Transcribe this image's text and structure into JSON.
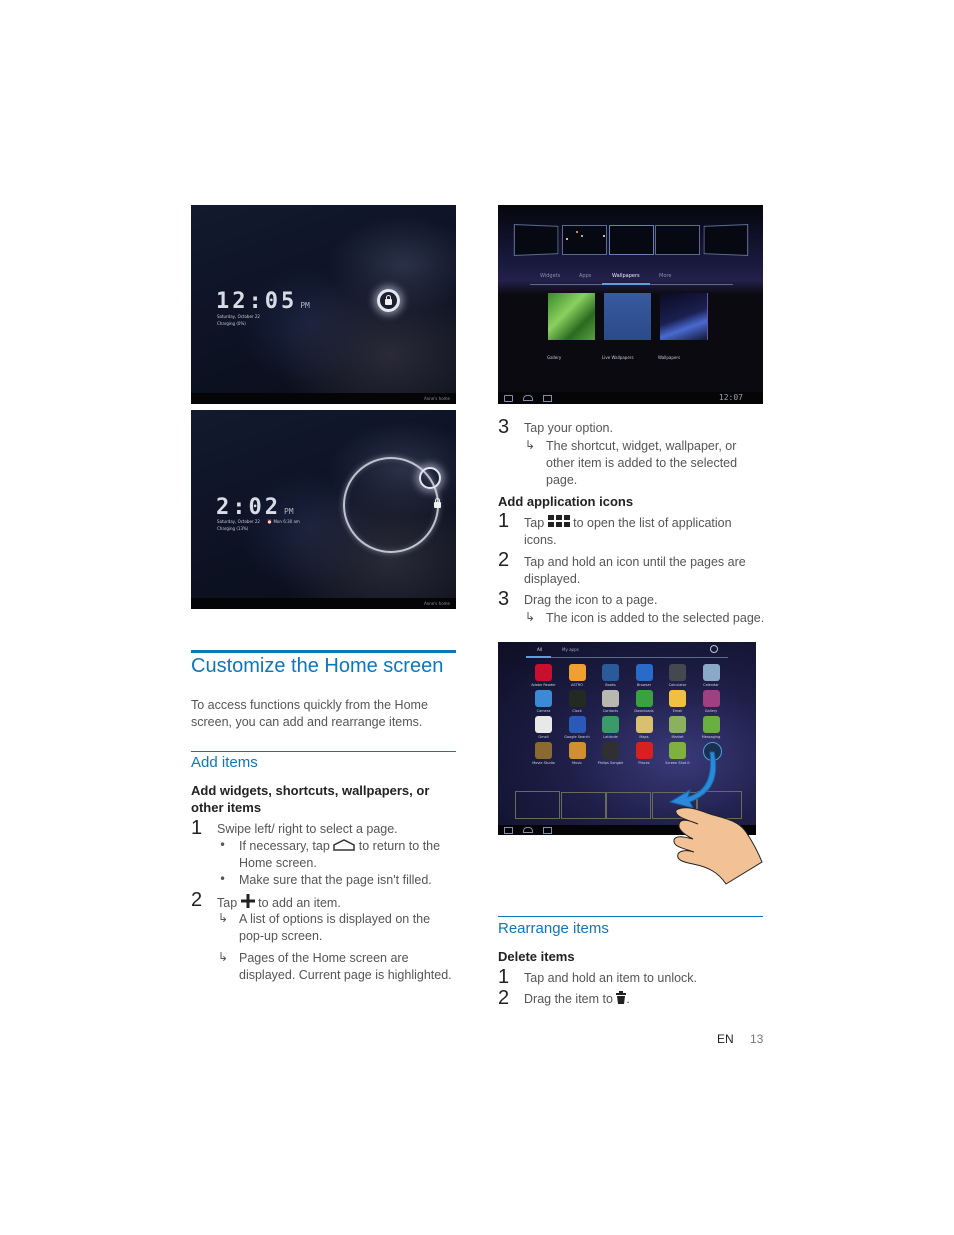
{
  "screenshots": {
    "lock1": {
      "time": "12:05",
      "ampm": "PM",
      "date": "Saturday, October 22",
      "charging": "Charging (0%)",
      "status": "Anne's home"
    },
    "lock2": {
      "time": "2:02",
      "ampm": "PM",
      "date": "Saturday, October 22",
      "alarm": "Mon 6:30 am",
      "charging": "Charging (13%)",
      "status": "Anne's home"
    },
    "wallpaper_picker": {
      "tabs": [
        "Widgets",
        "Apps",
        "Wallpapers",
        "More"
      ],
      "active_tab": "Wallpapers",
      "options": [
        "Gallery",
        "Live Wallpapers",
        "Wallpapers"
      ],
      "clock": "12:07"
    },
    "app_drawer": {
      "tabs": [
        "All",
        "My apps"
      ],
      "active_tab": "All",
      "apps": [
        {
          "label": "Adobe Reader",
          "color": "#c8102e"
        },
        {
          "label": "ASTRO",
          "color": "#f0a030"
        },
        {
          "label": "Books",
          "color": "#2a5a9a"
        },
        {
          "label": "Browser",
          "color": "#2a6ac8"
        },
        {
          "label": "Calculator",
          "color": "#444850"
        },
        {
          "label": "Calendar",
          "color": "#8aa8c8"
        },
        {
          "label": "Camera",
          "color": "#3a8ad8"
        },
        {
          "label": "Clock",
          "color": "#222a22"
        },
        {
          "label": "Contacts",
          "color": "#b8b8b0"
        },
        {
          "label": "Downloads",
          "color": "#3aa040"
        },
        {
          "label": "Email",
          "color": "#f0c040"
        },
        {
          "label": "Gallery",
          "color": "#a04080"
        },
        {
          "label": "Gmail",
          "color": "#e8e8e8"
        },
        {
          "label": "Google Search",
          "color": "#2a5ab8"
        },
        {
          "label": "Latitude",
          "color": "#3a9a6a"
        },
        {
          "label": "Maps",
          "color": "#d8c070"
        },
        {
          "label": "Market",
          "color": "#8ab060"
        },
        {
          "label": "Messaging",
          "color": "#6ab040"
        },
        {
          "label": "Movie Studio",
          "color": "#8a6a30"
        },
        {
          "label": "Music",
          "color": "#d09030"
        },
        {
          "label": "Philips Songbir",
          "color": "#303030"
        },
        {
          "label": "Places",
          "color": "#d82020"
        },
        {
          "label": "Screen Shot it",
          "color": "#80b040"
        },
        {
          "label": "",
          "color": "#1a3050"
        }
      ]
    }
  },
  "left_column": {
    "section_title": "Customize the Home screen",
    "intro": "To access functions quickly from the Home screen, you can add and rearrange items.",
    "subsection_title": "Add items",
    "subheading": "Add widgets, shortcuts, wallpapers, or other items",
    "steps": [
      {
        "num": "1",
        "text": "Swipe left/ right to select a page.",
        "bullets": [
          {
            "before": "If necessary, tap",
            "icon": "home-icon",
            "after": "to return to the Home screen."
          },
          {
            "text": "Make sure that the page isn't filled."
          }
        ]
      },
      {
        "num": "2",
        "before": "Tap",
        "icon": "plus-icon",
        "after": "to add an item.",
        "results": [
          "A list of options is displayed on the pop-up screen.",
          "Pages of the Home screen are displayed. Current page is highlighted."
        ]
      }
    ]
  },
  "right_column": {
    "step3": {
      "num": "3",
      "text": "Tap your option.",
      "result": "The shortcut, widget, wallpaper, or other item is added to the selected page."
    },
    "app_icons_heading": "Add application icons",
    "app_steps": [
      {
        "num": "1",
        "before": "Tap",
        "icon": "apps-grid-icon",
        "after": "to open the list of application icons."
      },
      {
        "num": "2",
        "text": "Tap and hold an icon until the pages are displayed."
      },
      {
        "num": "3",
        "text": "Drag the icon to a page.",
        "result": "The icon is added to the selected page."
      }
    ],
    "rearrange_title": "Rearrange items",
    "delete_heading": "Delete items",
    "delete_steps": [
      {
        "num": "1",
        "text": "Tap and hold an item to unlock."
      },
      {
        "num": "2",
        "before": "Drag the item to",
        "icon": "trash-icon",
        "after": "."
      }
    ]
  },
  "footer": {
    "lang": "EN",
    "page": "13"
  },
  "arrow_glyph": "↳",
  "bullet_glyph": "•"
}
